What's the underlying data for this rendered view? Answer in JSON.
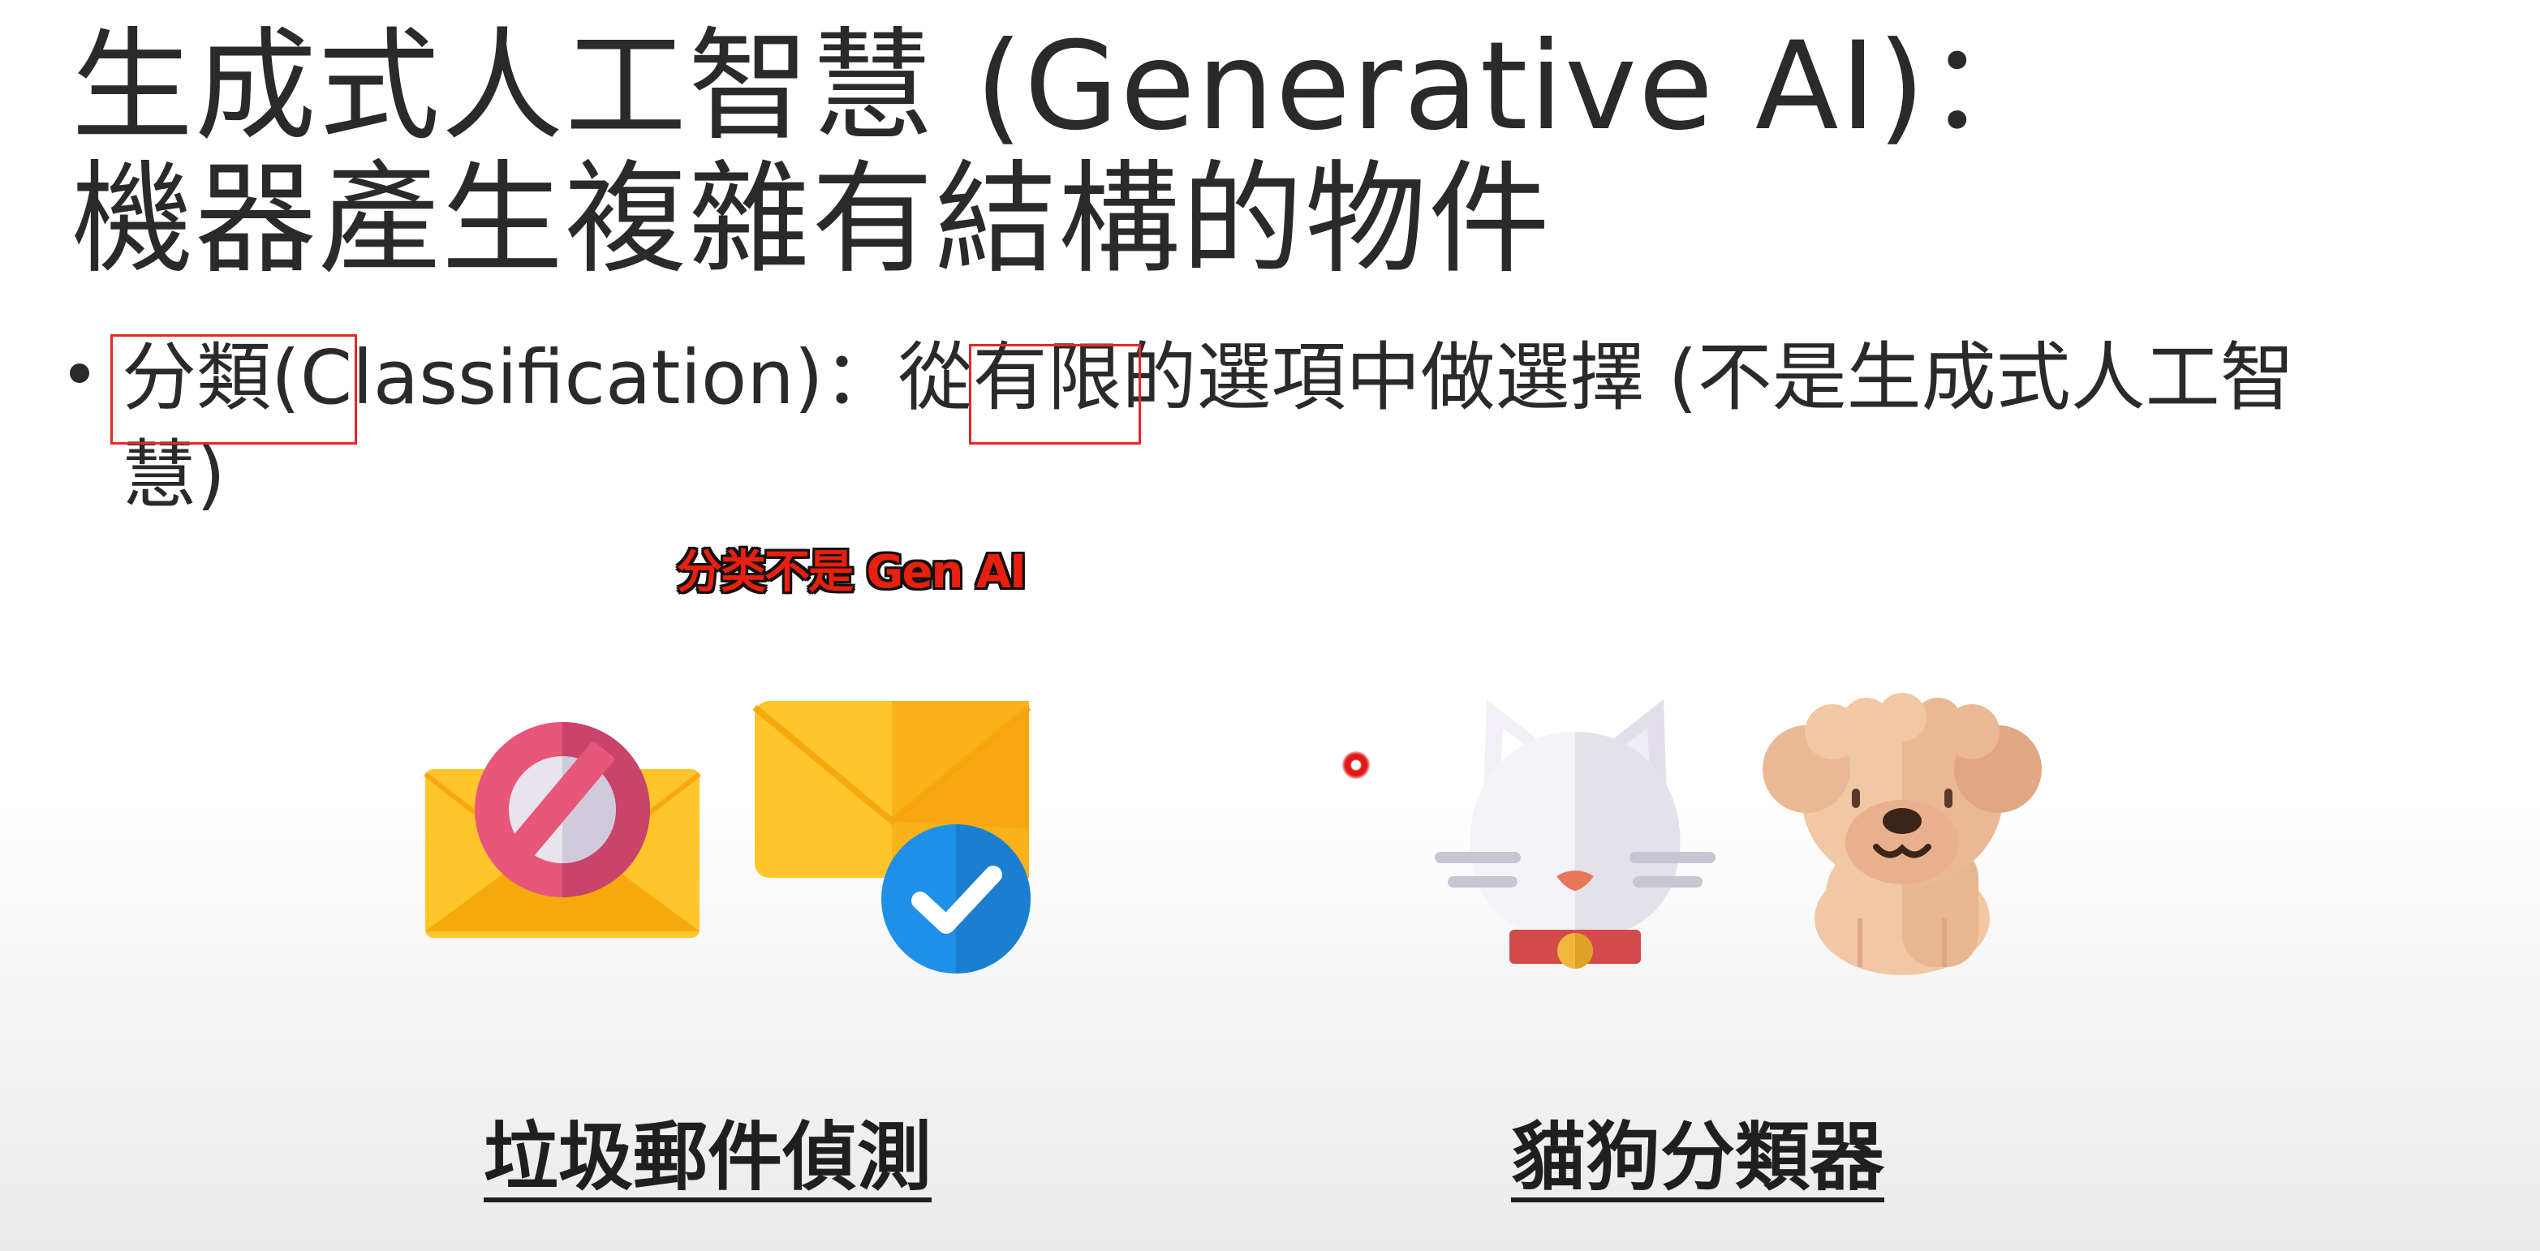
{
  "slide": {
    "title_line_1": "生成式人工智慧 (Generative AI)：",
    "title_line_2": "機器產生複雜有結構的物件",
    "bullet": {
      "part_highlight_1": "分類(C",
      "part_mid": "lassification)：從",
      "part_highlight_2": "有限",
      "part_rest": "的選項中做選擇 (不是生成式人工智",
      "wrap_line": "慧)"
    },
    "annotation": "分类不是 Gen AI",
    "captions": {
      "spam_detection": "垃圾郵件偵測",
      "cat_dog_classifier": "貓狗分類器"
    },
    "icons": {
      "spam_mail": "blocked-envelope-icon",
      "approved_mail": "envelope-check-icon",
      "cat": "cat-icon",
      "dog": "dog-icon"
    },
    "colors": {
      "highlight_box": "#e2292a",
      "annotation_text": "#e8200f",
      "envelope_yellow": "#ffc52b",
      "block_pink": "#e85a7d",
      "check_blue": "#1e90e8"
    }
  }
}
